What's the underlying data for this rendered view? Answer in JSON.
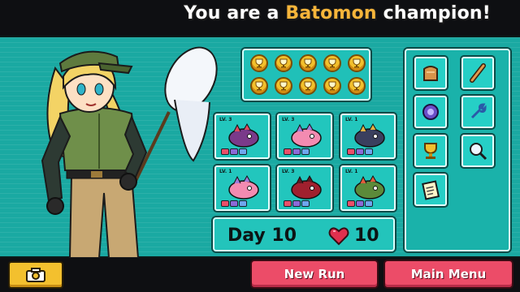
{
  "header": {
    "title_prefix": "You are a ",
    "title_accent": "Batomon",
    "title_suffix": " champion!"
  },
  "trophies": {
    "count": 10,
    "icon": "trophy-coin-icon"
  },
  "team": [
    {
      "level": "LV. 3",
      "icon": "serpent-monster-icon"
    },
    {
      "level": "LV. 3",
      "icon": "pufferfish-monster-icon"
    },
    {
      "level": "LV. 1",
      "icon": "cobra-monster-icon"
    },
    {
      "level": "LV. 1",
      "icon": "pufferfish-monster-icon"
    },
    {
      "level": "LV. 3",
      "icon": "crab-monster-icon"
    },
    {
      "level": "LV. 1",
      "icon": "plant-monster-icon"
    }
  ],
  "status": {
    "day_label": "Day 10",
    "lives": "10",
    "heart_icon": "heart-icon"
  },
  "items": [
    {
      "icon": "bread-icon"
    },
    {
      "icon": "bat-stick-icon"
    },
    {
      "icon": "orb-icon"
    },
    {
      "icon": "wrench-icon"
    },
    {
      "icon": "trophy-icon"
    },
    {
      "icon": "magnifier-icon"
    },
    {
      "icon": "notepad-icon"
    }
  ],
  "buttons": {
    "camera_icon": "camera-icon",
    "new_run": "New Run",
    "main_menu": "Main Menu"
  },
  "colors": {
    "background": "#1aa9a2",
    "accent": "#f6b53a",
    "button_red": "#ec4c68",
    "button_yellow": "#f3c02e"
  }
}
